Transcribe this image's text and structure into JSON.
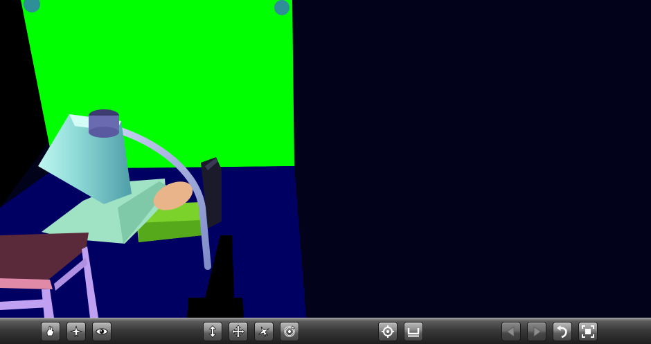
{
  "viewer": {
    "scene": {
      "colors": {
        "background": "#02021a",
        "back_wall": "#00ff00",
        "floor": "#000063",
        "lamp_shade": "#7fd6d6",
        "lamp_cap": "#6a6ab0",
        "lamp_arm": "#9aa8e0",
        "bed_sheet": "#9fe2c4",
        "bed_mattress": "#7ad22a",
        "pillow": "#e9b48a",
        "table_top": "#5a2a3a",
        "table_legs": "#c0a0f0",
        "table_rail": "#e08aa8"
      }
    },
    "toolbar": {
      "buttons": [
        {
          "name": "pan-mode-button",
          "icon": "hand-icon",
          "state": "enabled"
        },
        {
          "name": "fly-mode-button",
          "icon": "plane-icon",
          "state": "enabled"
        },
        {
          "name": "examine-mode-button",
          "icon": "eye-icon",
          "state": "enabled"
        },
        {
          "name": "move-up-down-button",
          "icon": "up-down-arrows-icon",
          "state": "enabled"
        },
        {
          "name": "move-cross-button",
          "icon": "four-way-arrows-icon",
          "state": "enabled"
        },
        {
          "name": "tilt-button",
          "icon": "tilt-icon",
          "state": "enabled"
        },
        {
          "name": "rotate-button",
          "icon": "rotate-icon",
          "state": "enabled"
        },
        {
          "name": "seek-button",
          "icon": "crosshair-icon",
          "state": "enabled"
        },
        {
          "name": "straighten-button",
          "icon": "level-icon",
          "state": "enabled"
        },
        {
          "name": "previous-viewpoint-button",
          "icon": "triangle-left-icon",
          "state": "disabled"
        },
        {
          "name": "next-viewpoint-button",
          "icon": "triangle-right-icon",
          "state": "disabled"
        },
        {
          "name": "return-button",
          "icon": "return-arrow-icon",
          "state": "enabled"
        },
        {
          "name": "fit-all-button",
          "icon": "fit-frame-icon",
          "state": "enabled"
        }
      ]
    }
  }
}
